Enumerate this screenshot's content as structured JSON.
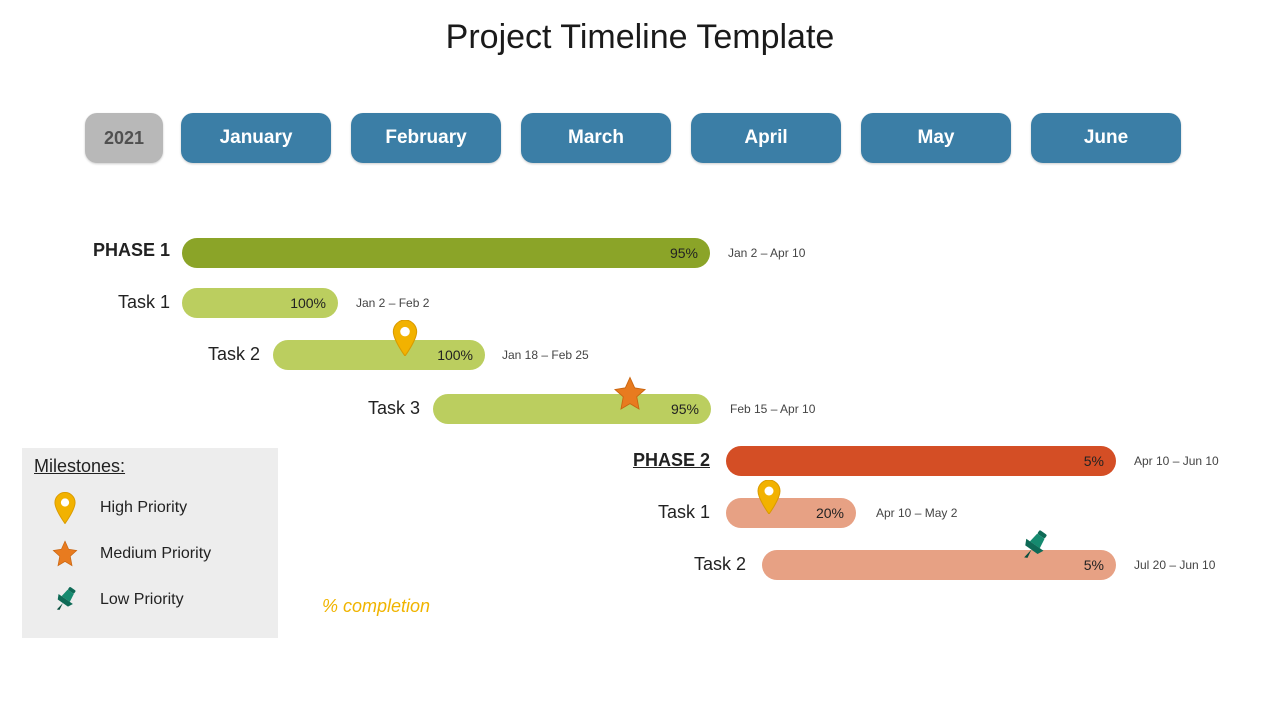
{
  "title": "Project Timeline Template",
  "year": "2021",
  "months": [
    "January",
    "February",
    "March",
    "April",
    "May",
    "June"
  ],
  "phases": [
    {
      "label": "PHASE 1",
      "pct": "95%",
      "dates": "Jan 2 – Apr 10"
    },
    {
      "label": "Task 1",
      "pct": "100%",
      "dates": "Jan 2 – Feb 2"
    },
    {
      "label": "Task 2",
      "pct": "100%",
      "dates": "Jan 18 – Feb 25"
    },
    {
      "label": "Task 3",
      "pct": "95%",
      "dates": "Feb 15 – Apr 10"
    },
    {
      "label": "PHASE 2",
      "pct": "5%",
      "dates": "Apr 10 – Jun 10"
    },
    {
      "label": "Task 1",
      "pct": "20%",
      "dates": "Apr 10 – May 2"
    },
    {
      "label": "Task 2",
      "pct": "5%",
      "dates": "Jul 20 – Jun 10"
    }
  ],
  "legend": {
    "title": "Milestones:",
    "items": [
      "High Priority",
      "Medium Priority",
      "Low Priority"
    ]
  },
  "completion_note": "% completion",
  "chart_data": {
    "type": "gantt",
    "year": 2021,
    "months": [
      "January",
      "February",
      "March",
      "April",
      "May",
      "June"
    ],
    "rows": [
      {
        "name": "PHASE 1",
        "type": "phase",
        "start": "Jan 2",
        "end": "Apr 10",
        "pct": 95,
        "color": "#8ba428"
      },
      {
        "name": "Task 1",
        "type": "task",
        "phase": "PHASE 1",
        "start": "Jan 2",
        "end": "Feb 2",
        "pct": 100,
        "color": "#bbce5f"
      },
      {
        "name": "Task 2",
        "type": "task",
        "phase": "PHASE 1",
        "start": "Jan 18",
        "end": "Feb 25",
        "pct": 100,
        "color": "#bbce5f",
        "milestone": "High Priority"
      },
      {
        "name": "Task 3",
        "type": "task",
        "phase": "PHASE 1",
        "start": "Feb 15",
        "end": "Apr 10",
        "pct": 95,
        "color": "#bbce5f",
        "milestone": "Medium Priority"
      },
      {
        "name": "PHASE 2",
        "type": "phase",
        "start": "Apr 10",
        "end": "Jun 10",
        "pct": 5,
        "color": "#d44e25"
      },
      {
        "name": "Task 1",
        "type": "task",
        "phase": "PHASE 2",
        "start": "Apr 10",
        "end": "May 2",
        "pct": 20,
        "color": "#e7a184",
        "milestone": "High Priority"
      },
      {
        "name": "Task 2",
        "type": "task",
        "phase": "PHASE 2",
        "start": "Jul 20",
        "end": "Jun 10",
        "pct": 5,
        "color": "#e7a184",
        "milestone": "Low Priority"
      }
    ],
    "milestone_legend": {
      "High Priority": "pin-yellow",
      "Medium Priority": "star-orange",
      "Low Priority": "pushpin-teal"
    }
  }
}
